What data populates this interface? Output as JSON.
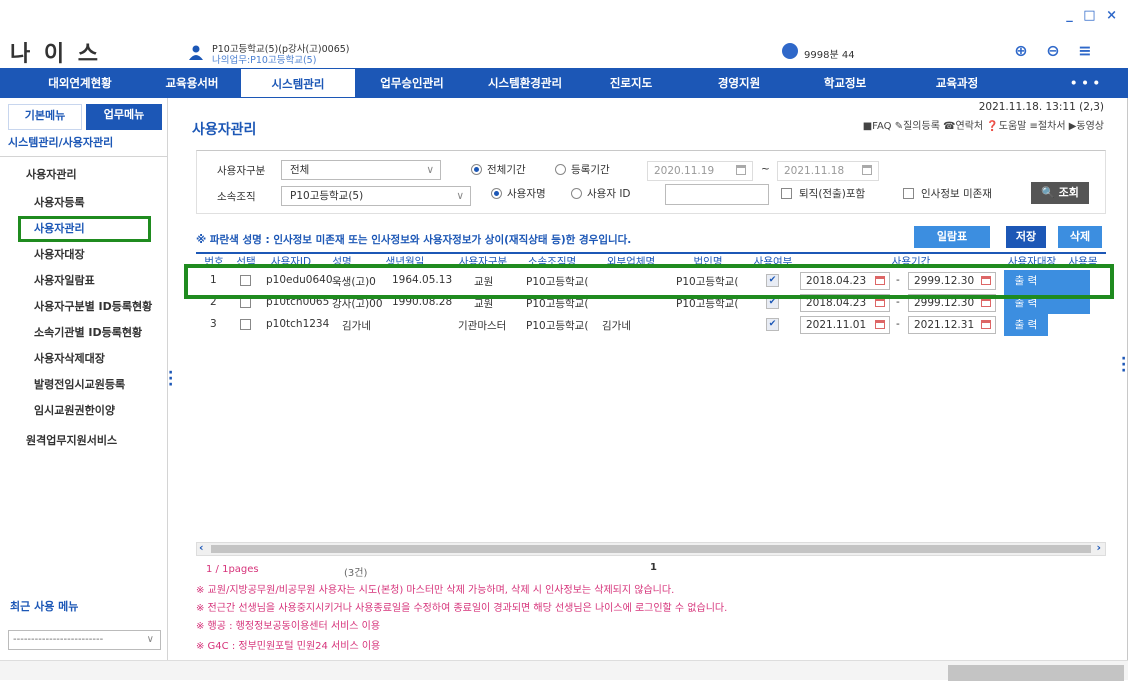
{
  "window": {
    "controls": "_ □ ×"
  },
  "app": {
    "logo": "나 이 스"
  },
  "user": {
    "line1": "P10고등학교(5)(p강사(고)0065)",
    "line2": "나의업무:P10고등학교(5)"
  },
  "session": {
    "timer": "9998분 44"
  },
  "menu": [
    "대외연계현황",
    "교육용서버",
    "시스템관리",
    "업무승인관리",
    "시스템환경관리",
    "진로지도",
    "경영지원",
    "학교정보",
    "교육과정",
    "• • •"
  ],
  "sidebar": {
    "tab_basic": "기본메뉴",
    "tab_work": "업무메뉴",
    "path": "시스템관리/사용자관리",
    "group": "사용자관리",
    "items": [
      "사용자등록",
      "사용자관리",
      "사용자대장",
      "사용자일람표",
      "사용자구분별 ID등록현황",
      "소속기관별 ID등록현황",
      "사용자삭제대장",
      "발령전임시교원등록",
      "임시교원권한이양"
    ],
    "group2": "원격업무지원서비스",
    "recent_label": "최근 사용 메뉴",
    "recent_value": "-------------------------"
  },
  "main": {
    "title": "사용자관리",
    "datetime": "2021.11.18. 13:11 (2,3)",
    "links": "■FAQ  ✎질의등록  ☎연락처  ❓도움말  ≡절차서  ▶동영상",
    "filter": {
      "user_type_label": "사용자구분",
      "user_type_value": "전체",
      "org_label": "소속조직",
      "org_value": "P10고등학교(5)",
      "period_all": "전체기간",
      "period_reg": "등록기간",
      "date_from": "2020.11.19",
      "tilde": "~",
      "date_to": "2021.11.18",
      "by_name": "사용자명",
      "by_id": "사용자 ID",
      "retired": "퇴직(전출)포함",
      "no_hr": "인사정보 미존재",
      "search_btn": "🔍 조회"
    },
    "notice": "※ 파란색 성명 : 인사정보 미존재 또는 인사정보와 사용자정보가 상이(재직상태 등)한 경우입니다.",
    "buttons": {
      "list": "일람표",
      "save": "저장",
      "delete": "삭제"
    },
    "table": {
      "headers": [
        "번호",
        "선택",
        "사용자ID",
        "성명",
        "생년월일",
        "사용자구분",
        "소속조직명",
        "외부업체명",
        "법인명",
        "사용여부",
        "사용기간",
        "사용자대장",
        "사용목"
      ],
      "rows": [
        {
          "no": "1",
          "id": "p10edu0640",
          "name": "욱생(고)0",
          "birth": "1964.05.13",
          "type": "교원",
          "org": "P10고등학교(",
          "vendor": "",
          "corp": "P10고등학교(",
          "use": "✔",
          "from": "2018.04.23",
          "dash": "-",
          "to": "2999.12.30",
          "out": "출 력"
        },
        {
          "no": "2",
          "id": "p10tch0065",
          "name": "강사(고)00",
          "birth": "1990.08.28",
          "type": "교원",
          "org": "P10고등학교(",
          "vendor": "",
          "corp": "P10고등학교(",
          "use": "✔",
          "from": "2018.04.23",
          "dash": "-",
          "to": "2999.12.30",
          "out": "출 력"
        },
        {
          "no": "3",
          "id": "p10tch1234",
          "name": "김가네",
          "birth": "",
          "type": "기관마스터",
          "org": "P10고등학교(",
          "vendor": "김가네",
          "corp": "",
          "use": "✔",
          "from": "2021.11.01",
          "dash": "-",
          "to": "2021.12.31",
          "out": "출 력"
        }
      ]
    },
    "pager": {
      "pages": "1 / 1pages",
      "count": "(3건)",
      "current": "1"
    },
    "footnotes": [
      "※ 교원/지방공무원/비공무원 사용자는 시도(본청) 마스터만 삭제 가능하며, 삭제 시 인사정보는 삭제되지 않습니다.",
      "※ 전근간 선생님을 사용중지시키거나 사용종료일을 수정하여 종료일이 경과되면 해당 선생님은 나이스에 로그인할 수 없습니다.",
      "※ 행공 : 행정정보공동이용센터 서비스 이용",
      "※ G4C : 정부민원포털 민원24 서비스 이용"
    ]
  },
  "colors": {
    "primary": "#1c57b6",
    "highlight": "#1f8b1f",
    "button": "#3c8ee0",
    "note": "#d6337a"
  }
}
